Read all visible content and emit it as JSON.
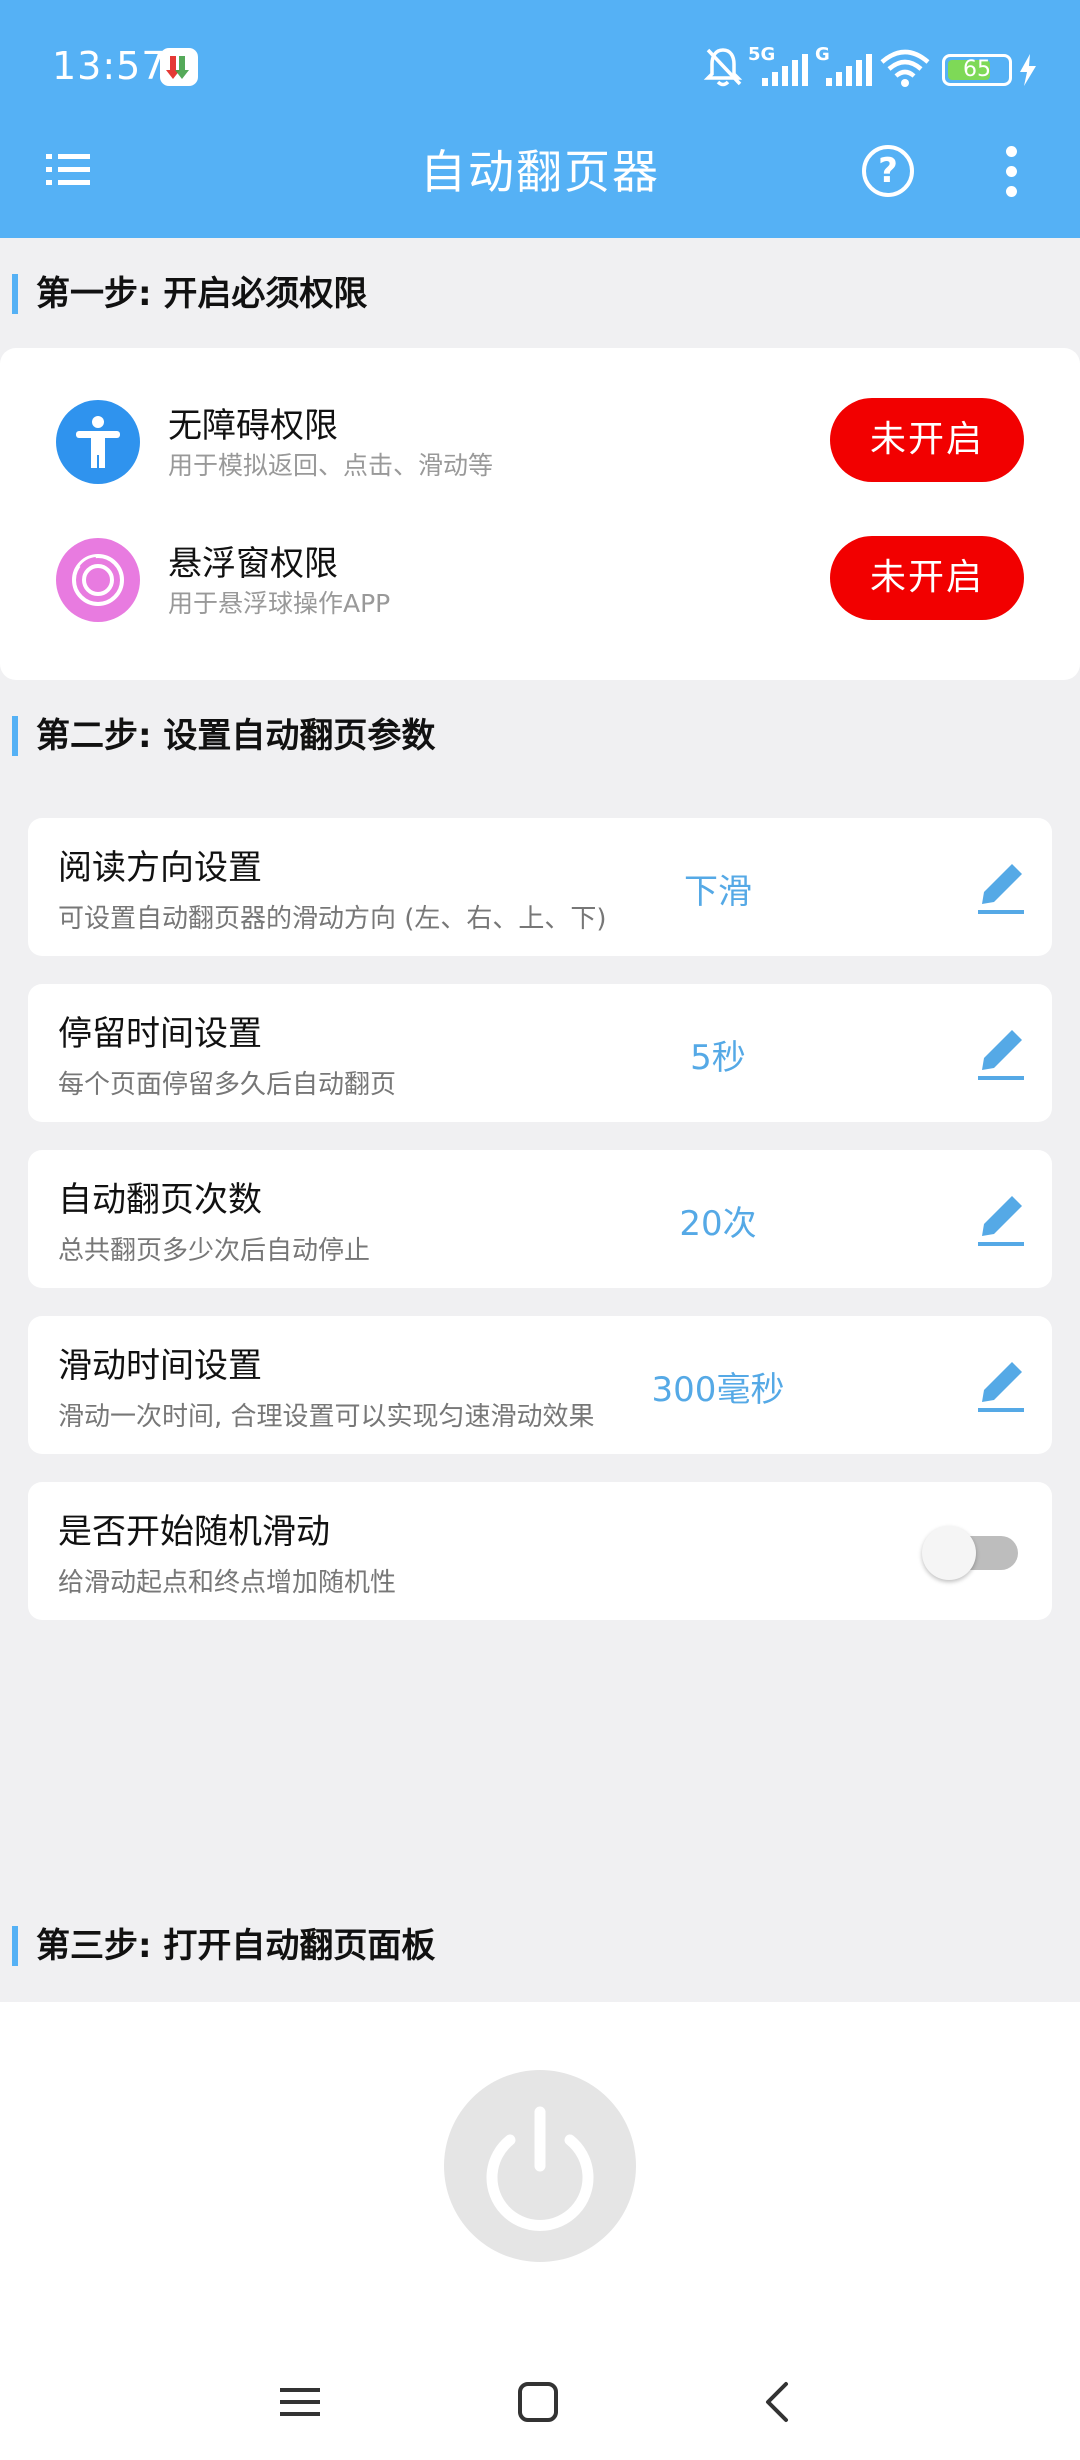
{
  "status_bar": {
    "time": "13:57",
    "network_5g": "5G",
    "network_g": "G",
    "battery": "65",
    "icons": [
      "app-notify-icon",
      "mute-bell-icon",
      "signal-icon",
      "wifi-icon",
      "battery-icon",
      "charging-icon"
    ]
  },
  "header": {
    "title": "自动翻页器",
    "menu_icon": "list-menu-icon",
    "help_label": "?",
    "more_icon": "more-vertical-icon"
  },
  "step1": {
    "title": "第一步: 开启必须权限",
    "permissions": [
      {
        "name": "无障碍权限",
        "desc": "用于模拟返回、点击、滑动等",
        "button": "未开启",
        "icon": "accessibility-icon",
        "icon_color": "#2f93ee"
      },
      {
        "name": "悬浮窗权限",
        "desc": "用于悬浮球操作APP",
        "button": "未开启",
        "icon": "floating-ball-icon",
        "icon_color": "#e87be0"
      }
    ]
  },
  "step2": {
    "title": "第二步: 设置自动翻页参数",
    "settings": [
      {
        "title": "阅读方向设置",
        "desc": "可设置自动翻页器的滑动方向 (左、右、上、下)",
        "value": "下滑"
      },
      {
        "title": "停留时间设置",
        "desc": "每个页面停留多久后自动翻页",
        "value": "5秒"
      },
      {
        "title": "自动翻页次数",
        "desc": "总共翻页多少次后自动停止",
        "value": "20次"
      },
      {
        "title": "滑动时间设置",
        "desc": "滑动一次时间, 合理设置可以实现匀速滑动效果",
        "value": "300毫秒"
      }
    ],
    "random": {
      "title": "是否开始随机滑动",
      "desc": "给滑动起点和终点增加随机性",
      "enabled": false
    }
  },
  "step3": {
    "title": "第三步: 打开自动翻页面板",
    "power_icon": "power-icon"
  },
  "navbar": {
    "icons": [
      "nav-menu-icon",
      "nav-home-icon",
      "nav-back-icon"
    ]
  },
  "colors": {
    "primary": "#55b1f5",
    "danger": "#f20000",
    "value_text": "#55a9e6",
    "background": "#f0f0f2"
  }
}
